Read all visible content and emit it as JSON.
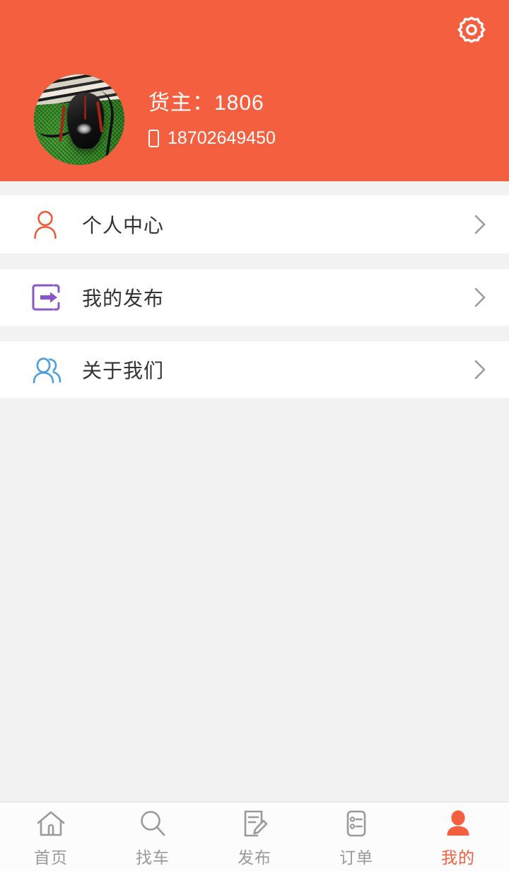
{
  "theme": {
    "accent": "#f4603f",
    "page_bg": "#f2f2f2",
    "row_bg": "#ffffff",
    "label_color": "#333333",
    "tab_inactive": "#9a9a9a",
    "tab_active": "#f4603f",
    "chevron_color": "#9b9b9b"
  },
  "header": {
    "settings_icon": "gear-icon",
    "avatar": {
      "icon": "avatar-photo",
      "description": "black gaming mouse on green mousepad"
    },
    "owner_label": "货主：1806",
    "phone_icon": "mobile-phone-icon",
    "phone_number": "18702649450"
  },
  "menu": {
    "items": [
      {
        "label": "个人中心",
        "icon": "user-outline-icon",
        "icon_color": "#f05a3c",
        "chevron": "chevron-right-icon"
      },
      {
        "label": "我的发布",
        "icon": "export-arrow-icon",
        "icon_color": "#8b55c8",
        "chevron": "chevron-right-icon"
      },
      {
        "label": "关于我们",
        "icon": "two-users-outline-icon",
        "icon_color": "#4a9ee0",
        "chevron": "chevron-right-icon"
      }
    ]
  },
  "tabbar": {
    "items": [
      {
        "label": "首页",
        "icon": "home-icon",
        "active": false
      },
      {
        "label": "找车",
        "icon": "search-icon",
        "active": false
      },
      {
        "label": "发布",
        "icon": "edit-document-icon",
        "active": false
      },
      {
        "label": "订单",
        "icon": "order-list-icon",
        "active": false
      },
      {
        "label": "我的",
        "icon": "user-filled-icon",
        "active": true
      }
    ]
  }
}
